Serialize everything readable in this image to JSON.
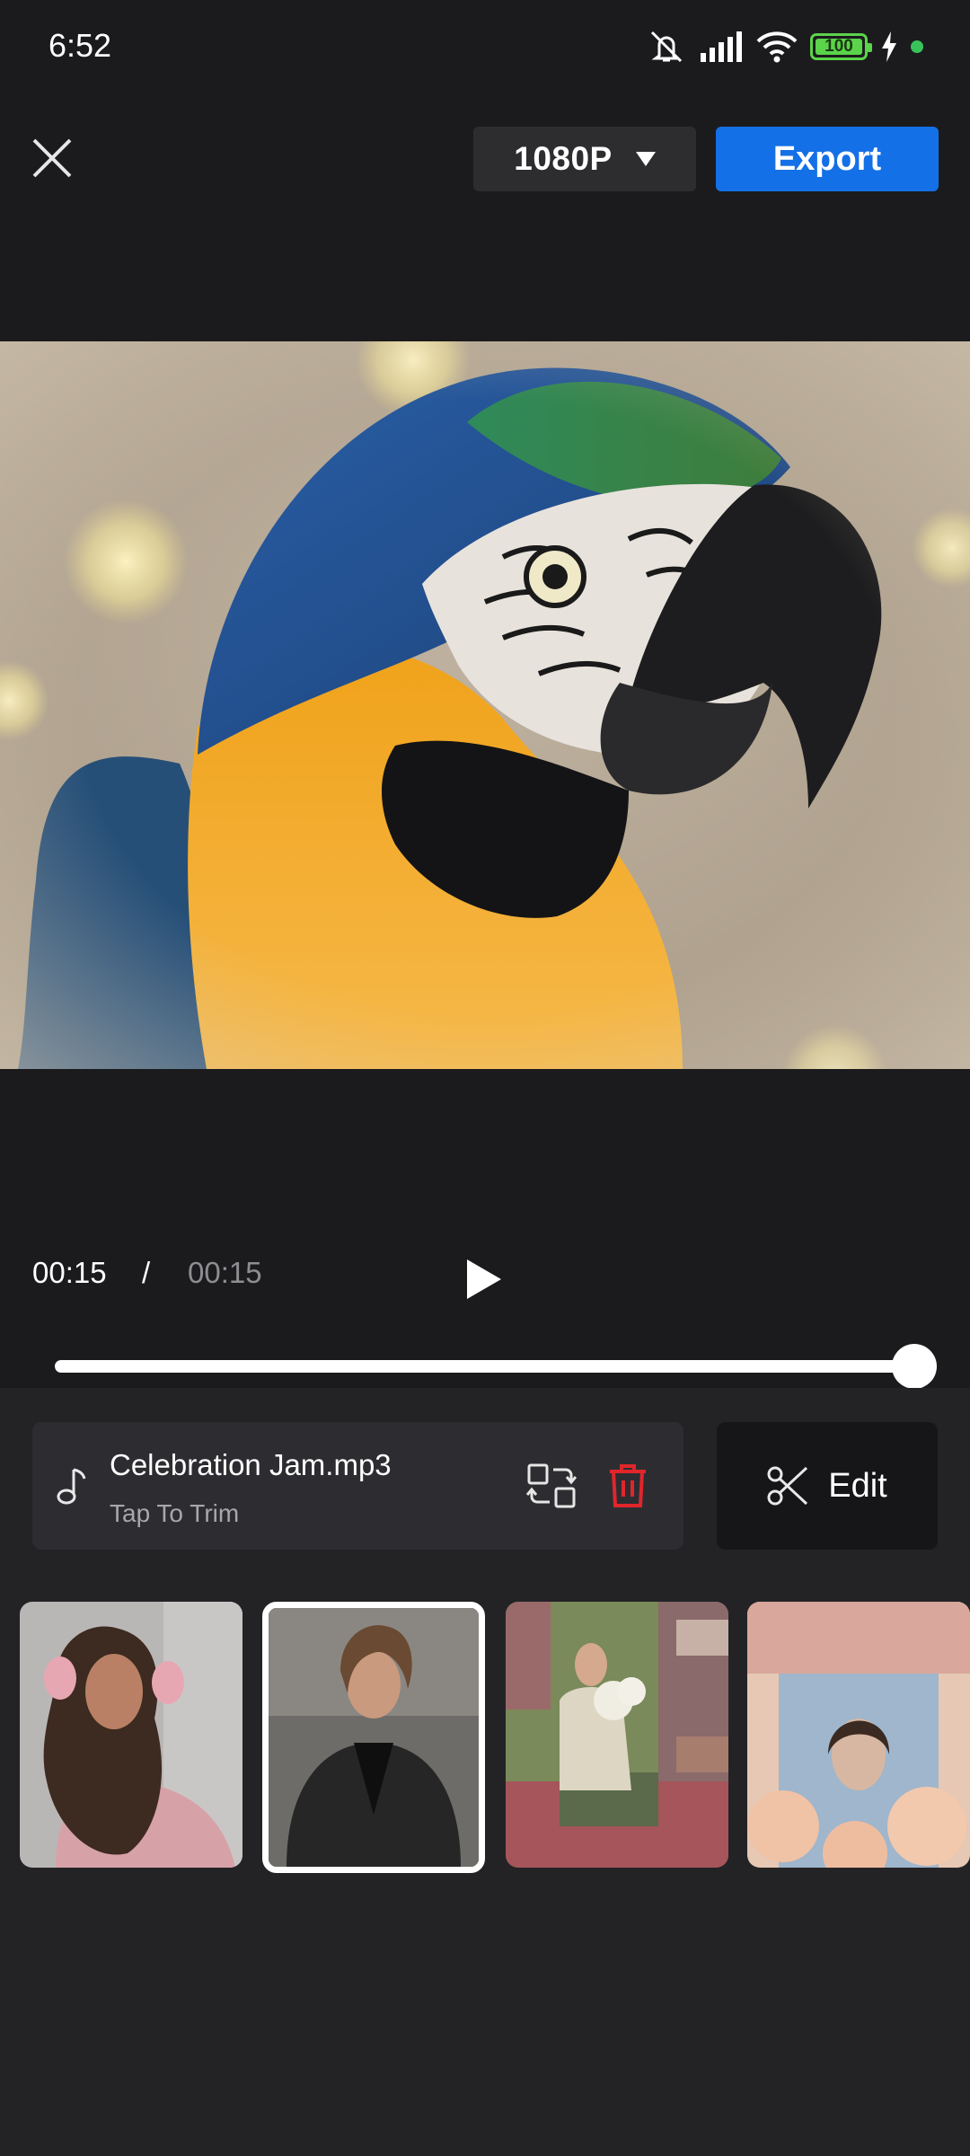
{
  "status_bar": {
    "time": "6:52",
    "battery": "100",
    "icons": [
      "mute-icon",
      "signal-icon",
      "wifi-icon",
      "battery-icon",
      "charging-icon",
      "dot-icon"
    ]
  },
  "toolbar": {
    "close_icon": "close-icon",
    "resolution_label": "1080P",
    "export_label": "Export"
  },
  "player": {
    "current_time": "00:15",
    "separator": "/",
    "total_time": "00:15",
    "progress": 1.0
  },
  "music": {
    "title": "Celebration Jam.mp3",
    "subtitle": "Tap To Trim",
    "icons": [
      "music-note-icon",
      "replace-icon",
      "delete-icon"
    ]
  },
  "edit": {
    "label": "Edit",
    "icon": "scissors-icon"
  },
  "thumbnails": {
    "selected_index": 1,
    "count": 4
  },
  "colors": {
    "accent": "#1470e6",
    "delete": "#e0262b",
    "background": "#1b1b1d"
  }
}
